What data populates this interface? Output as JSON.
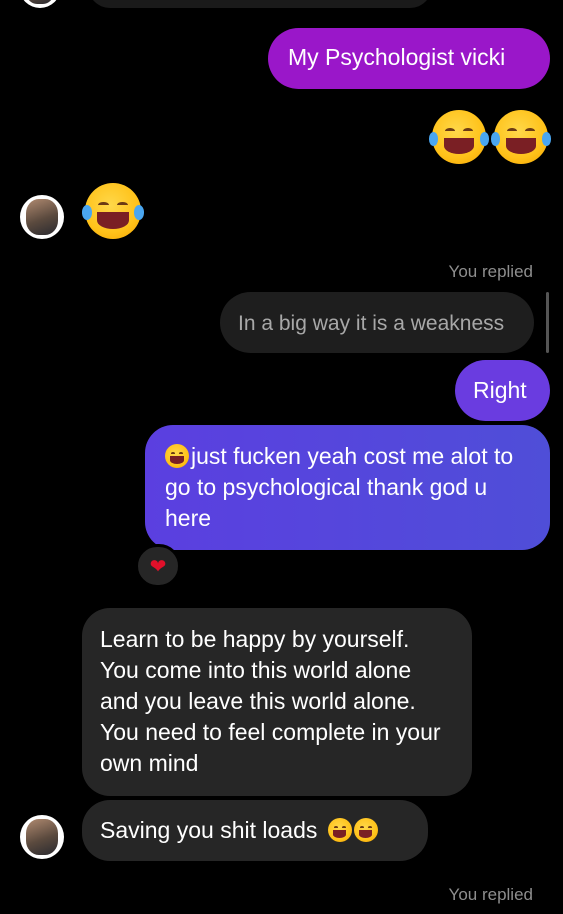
{
  "messages": {
    "sent_1": "My Psychologist vicki",
    "sent_2": "Right",
    "sent_3": "just fucken yeah cost me alot to go to psychological thank god u here",
    "recv_1": "Learn to be happy by yourself. You come into this world alone and you leave this world alone. You need to feel complete in your own mind",
    "recv_2": "Saving you shit loads"
  },
  "reply_context": {
    "label_1": "You replied",
    "quoted": "In a big way it is a weakness",
    "label_2": "You replied"
  },
  "reactions": {
    "heart": "❤"
  },
  "icons": {
    "laugh": "face-with-tears-of-joy",
    "heart": "red-heart"
  },
  "colors": {
    "background": "#000000",
    "sent_purple": "#9a17c9",
    "sent_violet": "#6a3ce0",
    "sent_blue": "#5b3fe0",
    "received": "#262626",
    "heart": "#e0102a"
  }
}
